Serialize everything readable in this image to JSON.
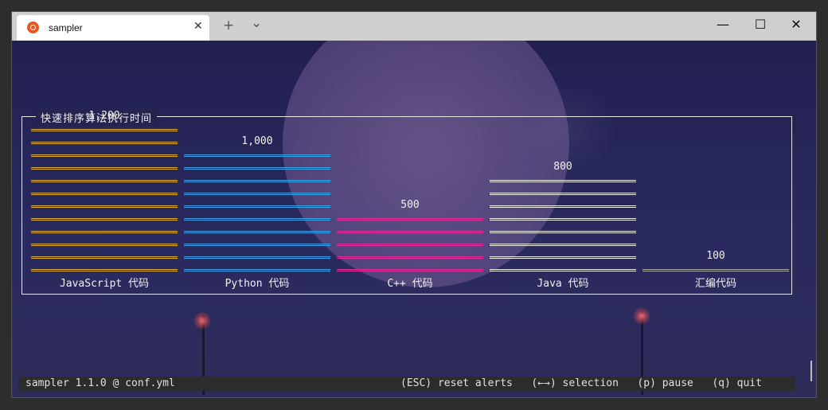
{
  "window": {
    "tab_title": "sampler",
    "new_tab": "+",
    "dropdown": "⌄",
    "minimize": "—",
    "maximize": "☐",
    "close": "✕",
    "tab_close": "✕"
  },
  "chart_data": {
    "type": "bar",
    "title": "快速排序算法执行时间",
    "categories": [
      "JavaScript 代码",
      "Python 代码",
      "C++ 代码",
      "Java 代码",
      "汇编代码"
    ],
    "values": [
      1200,
      1000,
      500,
      800,
      100
    ],
    "value_labels": [
      "1,200",
      "1,000",
      "500",
      "800",
      "100"
    ],
    "colors": [
      "#e0b030",
      "#3aa0e8",
      "#e0309a",
      "#f0f0f0",
      "#a8a8a8"
    ],
    "ylim": [
      0,
      1200
    ]
  },
  "statusbar": {
    "left": "sampler 1.1.0 @ conf.yml",
    "right": "(ESC) reset alerts   (←→) selection   (p) pause   (q) quit"
  }
}
